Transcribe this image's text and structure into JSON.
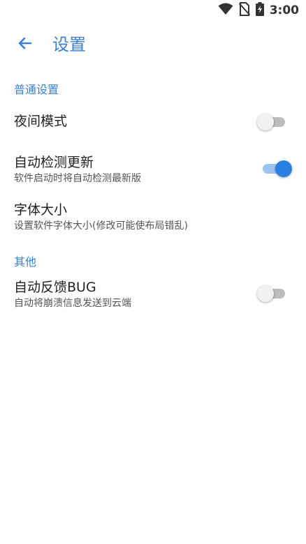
{
  "status_bar": {
    "time": "3:00",
    "icons": [
      "wifi-icon",
      "no-sim-icon",
      "battery-charging-icon"
    ]
  },
  "app_bar": {
    "title": "设置",
    "back_icon": "arrow-left-icon"
  },
  "colors": {
    "accent": "#3b7fd0",
    "switch_on": "#2a7fe0",
    "switch_on_track": "#9dc3ee",
    "switch_off_thumb": "#f1f1f1",
    "switch_off_track": "#bdbdbd"
  },
  "sections": {
    "general": {
      "header": "普通设置",
      "night_mode": {
        "title": "夜间模式",
        "enabled": false
      },
      "auto_update": {
        "title": "自动检测更新",
        "summary": "软件启动时将自动检测最新版",
        "enabled": true
      },
      "font_size": {
        "title": "字体大小",
        "summary": "设置软件字体大小(修改可能使布局错乱)"
      }
    },
    "other": {
      "header": "其他",
      "bug_report": {
        "title": "自动反馈BUG",
        "summary": "自动将崩溃信息发送到云端",
        "enabled": false
      }
    }
  }
}
